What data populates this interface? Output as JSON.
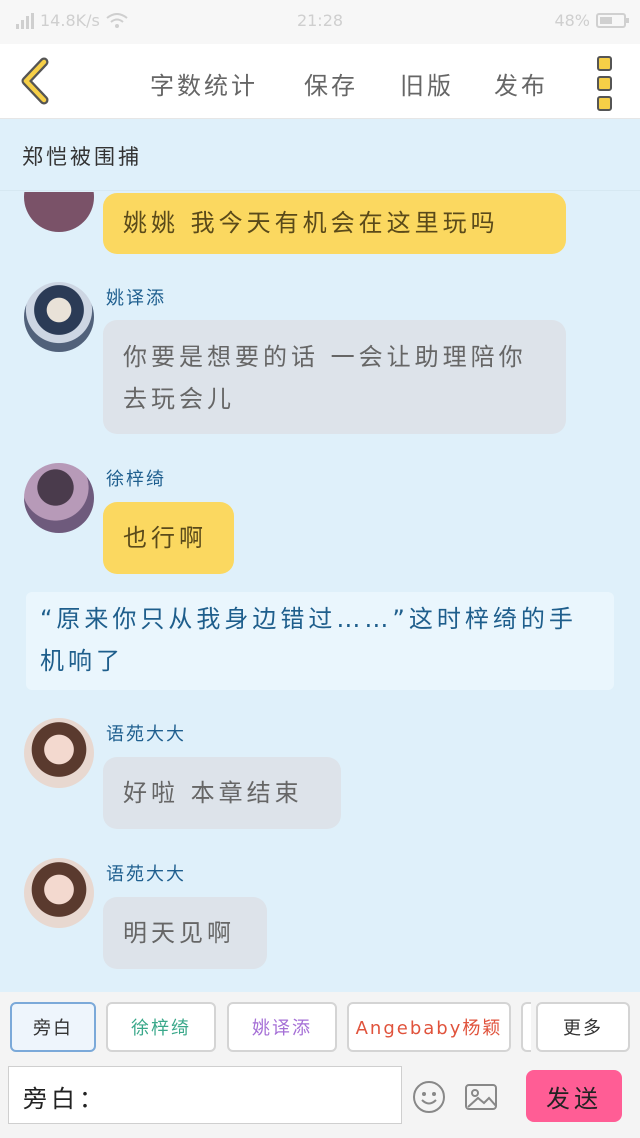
{
  "status_bar": {
    "speed": "14.8K/s",
    "time": "21:28",
    "battery": "48%"
  },
  "toolbar": {
    "word_count": "字数统计",
    "save": "保存",
    "old_version": "旧版",
    "publish": "发布"
  },
  "title": "郑恺被围捕",
  "messages": [
    {
      "speaker": "",
      "text": "姚姚 我今天有机会在这里玩吗",
      "style": "yellow"
    },
    {
      "speaker": "姚译添",
      "text": "你要是想要的话 一会让助理陪你去玩会儿",
      "style": "gray"
    },
    {
      "speaker": "徐梓绮",
      "text": "也行啊",
      "style": "yellow"
    },
    {
      "narration": "“原来你只从我身边错过……”这时梓绮的手机响了"
    },
    {
      "speaker": "语苑大大",
      "text": "好啦 本章结束",
      "style": "gray"
    },
    {
      "speaker": "语苑大大",
      "text": "明天见啊",
      "style": "gray"
    }
  ],
  "roles": [
    "旁白",
    "徐梓绮",
    "姚译添",
    "Angebaby杨颖",
    "更多"
  ],
  "role_colors": {
    "旁白": "#333333",
    "徐梓绮": "#3aa88a",
    "姚译添": "#a56fd6",
    "Angebaby杨颖": "#e0533c",
    "更多": "#333333"
  },
  "input": {
    "value": "旁白："
  },
  "send": "发送",
  "icons": {
    "emoji": "smiley-icon",
    "image": "image-icon"
  }
}
